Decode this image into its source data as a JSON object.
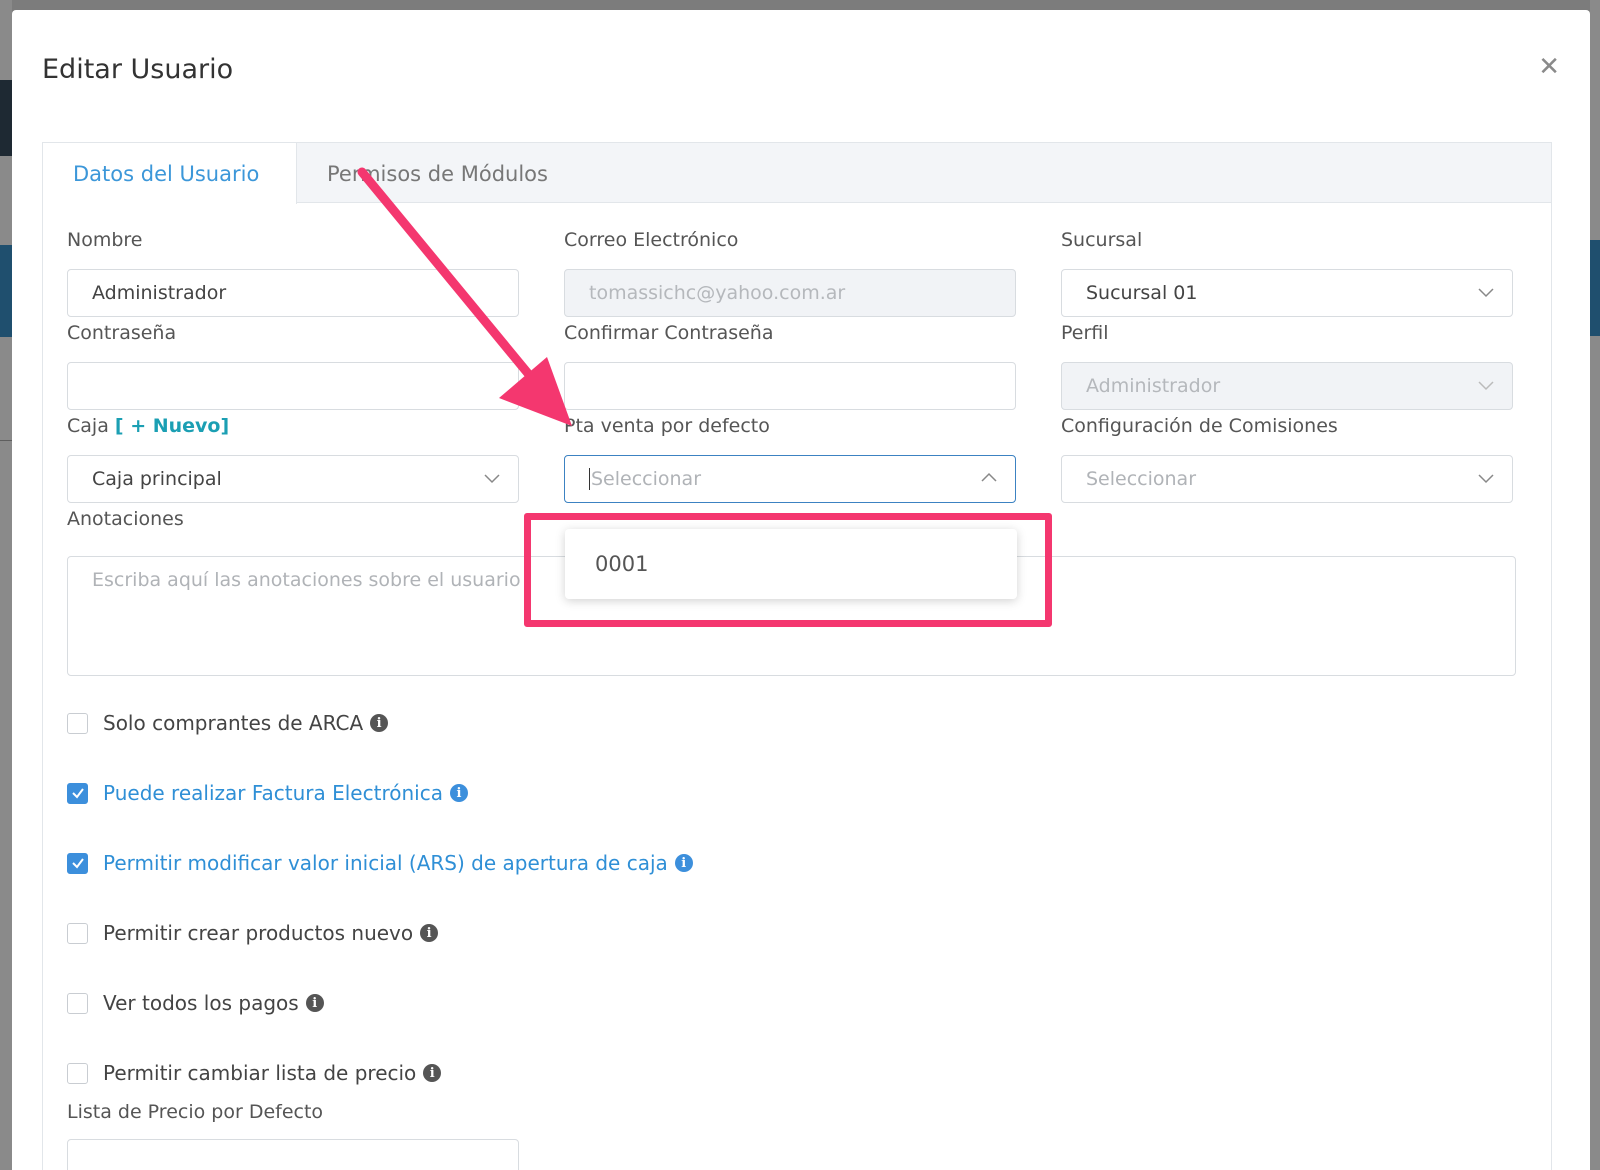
{
  "modal": {
    "title": "Editar Usuario"
  },
  "tabs": [
    {
      "label": "Datos del Usuario",
      "active": true
    },
    {
      "label": "Permisos de Módulos",
      "active": false
    }
  ],
  "form": {
    "nombre": {
      "label": "Nombre",
      "value": "Administrador"
    },
    "correo": {
      "label": "Correo Electrónico",
      "value": "tomassichc@yahoo.com.ar",
      "disabled": true
    },
    "sucursal": {
      "label": "Sucursal",
      "value": "Sucursal 01"
    },
    "contrasena": {
      "label": "Contraseña",
      "value": ""
    },
    "confirmar": {
      "label": "Confirmar Contraseña",
      "value": ""
    },
    "perfil": {
      "label": "Perfil",
      "value": "Administrador",
      "disabled": true
    },
    "caja": {
      "label": "Caja",
      "nuevo_label": "[ + Nuevo]",
      "value": "Caja principal"
    },
    "pta_venta": {
      "label": "Pta venta por defecto",
      "placeholder": "Seleccionar",
      "open": true,
      "options": [
        "0001"
      ]
    },
    "comisiones": {
      "label": "Configuración de Comisiones",
      "placeholder": "Seleccionar"
    },
    "anotaciones": {
      "label": "Anotaciones",
      "placeholder": "Escriba aquí las anotaciones sobre el usuario"
    },
    "lista_precio": {
      "label": "Lista de Precio por Defecto"
    }
  },
  "checkboxes": [
    {
      "label": "Solo comprantes de ARCA",
      "checked": false
    },
    {
      "label": "Puede realizar Factura Electrónica",
      "checked": true
    },
    {
      "label": "Permitir modificar valor inicial (ARS) de apertura de caja",
      "checked": true
    },
    {
      "label": "Permitir crear productos nuevo",
      "checked": false
    },
    {
      "label": "Ver todos los pagos",
      "checked": false
    },
    {
      "label": "Permitir cambiar lista de precio",
      "checked": false
    }
  ],
  "colors": {
    "accent": "#3c8fdc",
    "annotation": "#f4376f",
    "link": "#1b9fb3"
  },
  "icons": {
    "close": "close-icon",
    "chevron": "chevron-down-icon",
    "info": "info-icon",
    "check": "check-icon"
  }
}
